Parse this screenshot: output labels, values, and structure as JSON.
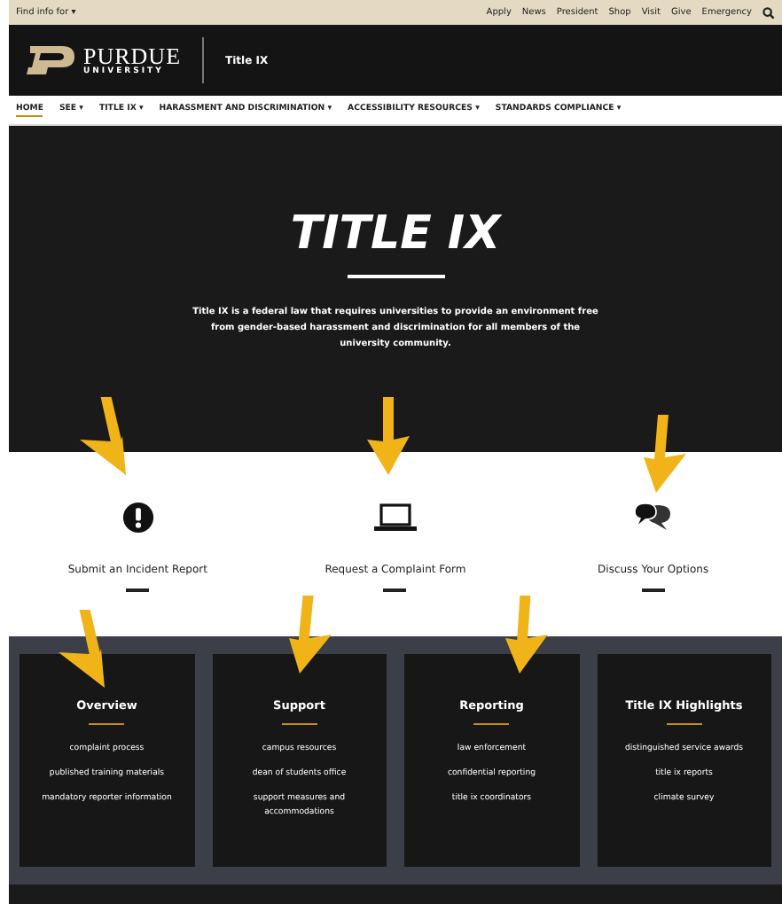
{
  "top_bar": {
    "audience_menu": "Find info for ▾",
    "links": [
      "Apply",
      "News",
      "President",
      "Shop",
      "Visit",
      "Give",
      "Emergency"
    ]
  },
  "header": {
    "logo_name": "PURDUE",
    "logo_sub": "UNIVERSITY",
    "site_title": "Title IX"
  },
  "nav": [
    {
      "label": "HOME",
      "selected": true
    },
    {
      "label": "SEE ▾",
      "selected": false
    },
    {
      "label": "TITLE IX ▾",
      "selected": false
    },
    {
      "label": "HARASSMENT AND DISCRIMINATION ▾",
      "selected": false
    },
    {
      "label": "ACCESSIBILITY RESOURCES ▾",
      "selected": false
    },
    {
      "label": "STANDARDS COMPLIANCE ▾",
      "selected": false
    }
  ],
  "hero": {
    "title": "TITLE IX",
    "text": "Title IX is a federal law that requires universities to provide an environment free from gender-based harassment and discrimination for all members of the university community."
  },
  "actions": [
    {
      "kind": "alert",
      "label": "Submit an Incident Report"
    },
    {
      "kind": "laptop",
      "label": "Request a Complaint Form"
    },
    {
      "kind": "chat",
      "label": "Discuss Your Options"
    }
  ],
  "cards": [
    {
      "title": "Overview",
      "links": [
        "complaint process",
        "published training materials",
        "mandatory reporter information"
      ]
    },
    {
      "title": "Support",
      "links": [
        "campus resources",
        "dean of students office",
        "support measures and accommodations"
      ]
    },
    {
      "title": "Reporting",
      "links": [
        "law enforcement",
        "confidential reporting",
        "title ix coordinators"
      ]
    },
    {
      "title": "Title IX Highlights",
      "links": [
        "distinguished service awards",
        "title ix reports",
        "climate survey"
      ]
    }
  ]
}
